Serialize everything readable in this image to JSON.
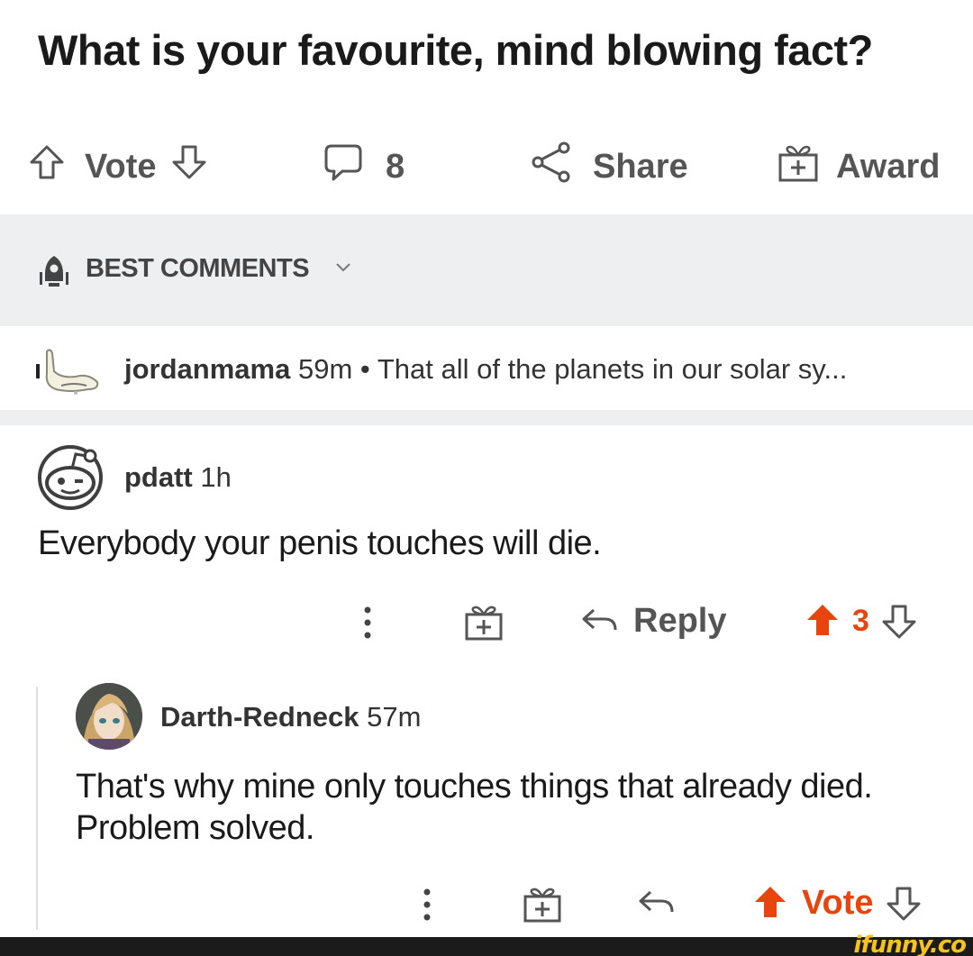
{
  "post": {
    "title": "What is your favourite, mind blowing fact?"
  },
  "actions": {
    "vote_label": "Vote",
    "comment_count": "8",
    "share_label": "Share",
    "award_label": "Award"
  },
  "sort": {
    "label": "BEST COMMENTS"
  },
  "collapsed_comment": {
    "username": "jordanmama",
    "time": "59m",
    "separator": "•",
    "preview": "That all of the planets in our solar sy..."
  },
  "comment1": {
    "username": "pdatt",
    "time": "1h",
    "body": "Everybody your penis touches will die.",
    "reply_label": "Reply",
    "score": "3"
  },
  "comment2": {
    "username": "Darth-Redneck",
    "time": "57m",
    "body": "That's why mine only touches things that already died. Problem solved.",
    "vote_label": "Vote"
  },
  "watermark": "ifunny.co",
  "colors": {
    "accent": "#e8440d",
    "icon_gray": "#555555",
    "band_gray": "#eeeff1"
  }
}
